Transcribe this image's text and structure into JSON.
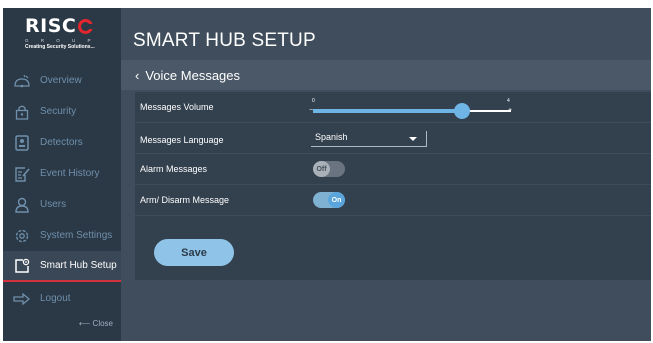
{
  "brand": {
    "name": "RISC",
    "group": "G R O U P",
    "tagline": "Creating Security Solutions..."
  },
  "sidebar": {
    "items": [
      {
        "label": "Overview",
        "icon": "overview-icon"
      },
      {
        "label": "Security",
        "icon": "lock-icon"
      },
      {
        "label": "Detectors",
        "icon": "detector-icon"
      },
      {
        "label": "Event History",
        "icon": "history-icon"
      },
      {
        "label": "Users",
        "icon": "user-icon"
      },
      {
        "label": "System Settings",
        "icon": "gear-icon"
      },
      {
        "label": "Smart Hub Setup",
        "icon": "hub-setup-icon",
        "active": true
      },
      {
        "label": "Logout",
        "icon": "logout-icon"
      }
    ],
    "close_label": "⟵ Close"
  },
  "header": {
    "title": "SMART HUB SETUP"
  },
  "subheader": {
    "back_label": "Voice Messages"
  },
  "form": {
    "volume": {
      "label": "Messages Volume",
      "min": "0",
      "max": "4",
      "value": 3
    },
    "language": {
      "label": "Messages Language",
      "value": "Spanish"
    },
    "alarm": {
      "label": "Alarm Messages",
      "state": "Off"
    },
    "arm": {
      "label": "Arm/ Disarm Message",
      "state": "On"
    }
  },
  "actions": {
    "save_label": "Save"
  },
  "colors": {
    "sidebar_bg": "#2b3845",
    "main_bg": "#3f4d5c",
    "accent": "#6eb4e5",
    "active_marker": "#d1323b"
  }
}
